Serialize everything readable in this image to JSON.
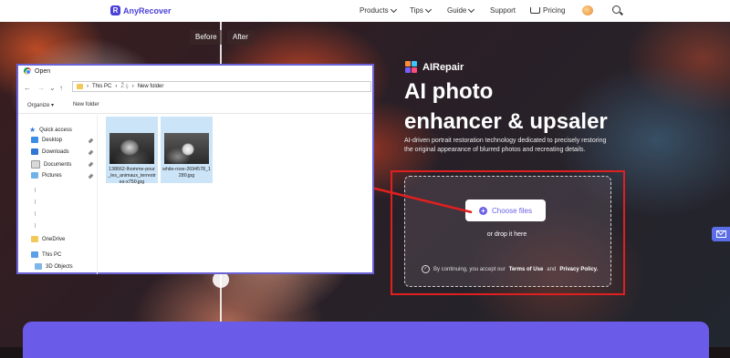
{
  "nav": {
    "logo": "AnyRecover",
    "items": [
      {
        "label": "Products",
        "caret": true
      },
      {
        "label": "Tips",
        "caret": true
      },
      {
        "label": "Guide",
        "caret": true
      },
      {
        "label": "Support",
        "caret": false
      },
      {
        "label": "Pricing",
        "caret": false
      }
    ]
  },
  "compare": {
    "before": "Before",
    "after": "After"
  },
  "hero": {
    "brand": "AIRepair",
    "headline_1": "AI photo",
    "headline_2": "enhancer & upsaler",
    "description": "AI-driven portrait restoration technology dedicated to precisely restoring the original appearance of blurred photos and recreating details.",
    "choose_button": "Choose files",
    "drop_text": "or drop it here",
    "consent_prefix": "By continuing, you accept our ",
    "terms": "Terms of Use",
    "consent_and": " and ",
    "privacy": "Privacy Policy."
  },
  "dialog": {
    "title": "Open",
    "path_this_pc": "This PC",
    "path_blurred": "Ž ç ",
    "path_folder": "New folder",
    "organize": "Organize ▾",
    "new_folder": "New folder",
    "nav_items": [
      {
        "label": "Quick access",
        "icon": "star-icon",
        "pinned": false
      },
      {
        "label": "Desktop",
        "icon": "desktop-icon",
        "pinned": true
      },
      {
        "label": "Downloads",
        "icon": "download-icon",
        "pinned": true
      },
      {
        "label": "Documents",
        "icon": "documents-icon",
        "pinned": true
      },
      {
        "label": "Pictures",
        "icon": "pictures-icon",
        "pinned": true
      },
      {
        "label": "OneDrive",
        "icon": "onedrive-icon",
        "pinned": false
      },
      {
        "label": "This PC",
        "icon": "pc-icon",
        "pinned": false
      },
      {
        "label": "3D Objects",
        "icon": "cube-icon",
        "pinned": false
      }
    ],
    "files": [
      {
        "name": "138662-lhomme-pour_les_animaux_terrestres-x750.jpg",
        "thumb": "man-photo"
      },
      {
        "name": "white-rose-2694578_1280.jpg",
        "thumb": "rose-photo"
      }
    ]
  },
  "colors": {
    "accent": "#6b61e6",
    "brand": "#4a3fd8",
    "highlight": "#e02020",
    "band": "#6a5be8"
  }
}
